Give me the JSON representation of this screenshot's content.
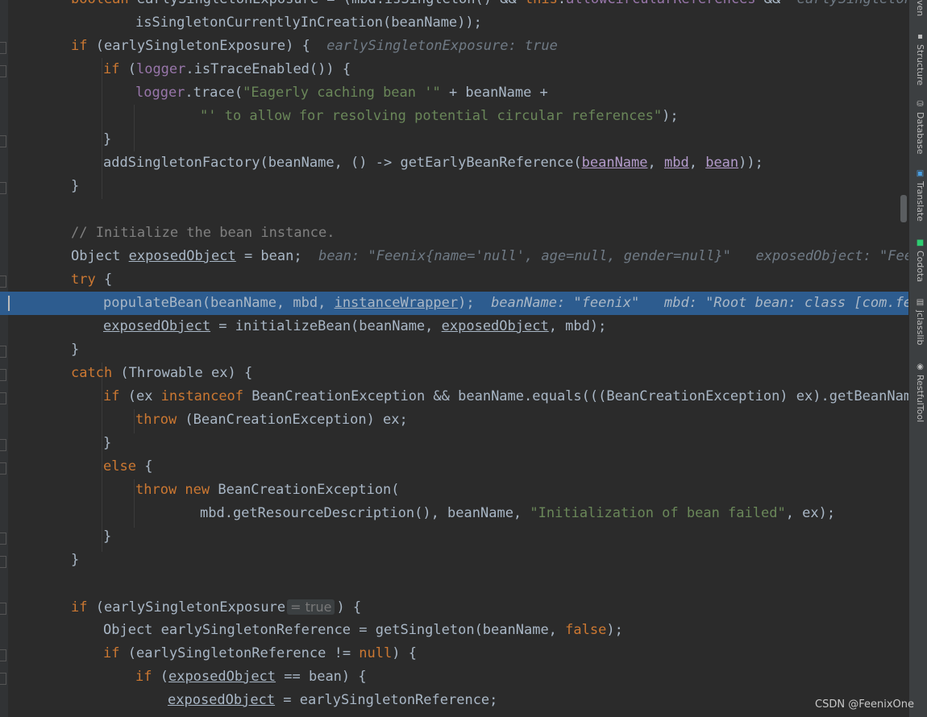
{
  "code": {
    "l0": {
      "kw1": "boolean",
      "p1": " earlySingletonExposure = (mbd.isSingleton() && ",
      "kw2": "this",
      "p2": ".",
      "f1": "allowCircularReferences",
      "p3": " &&  ",
      "hint": "earlySingletonEx"
    },
    "l1": {
      "p1": "isSingletonCurrentlyInCreation(beanName));"
    },
    "l2": {
      "kw1": "if",
      "p1": " (earlySingletonExposure) {  ",
      "hint": "earlySingletonExposure: true"
    },
    "l3": {
      "kw1": "if",
      "p1": " (",
      "f1": "logger",
      "p2": ".isTraceEnabled()) {"
    },
    "l4": {
      "f1": "logger",
      "p1": ".trace(",
      "s1": "\"Eagerly caching bean '\"",
      "p2": " + beanName +"
    },
    "l5": {
      "s1": "\"' to allow for resolving potential circular references\"",
      "p1": ");"
    },
    "l6": {
      "p1": "}"
    },
    "l7": {
      "p1": "addSingletonFactory(beanName, () -> getEarlyBeanReference(",
      "u1": "beanName",
      "p2": ", ",
      "u2": "mbd",
      "p3": ", ",
      "u3": "bean",
      "p4": "));"
    },
    "l8": {
      "p1": "}"
    },
    "l10": {
      "c1": "// Initialize the bean instance."
    },
    "l11": {
      "p1": "Object ",
      "u1": "exposedObject",
      "p2": " = bean;  ",
      "hint": "bean: \"Feenix{name='null', age=null, gender=null}\"   exposedObject: \"Feen"
    },
    "l12": {
      "kw1": "try",
      "p1": " {"
    },
    "l13": {
      "p1": "populateBean(beanName, mbd, ",
      "u1": "instanceWrapper",
      "p2": ");  ",
      "hint": "beanName: \"feenix\"   mbd: \"Root bean: class [com.fee"
    },
    "l14": {
      "u1": "exposedObject",
      "p1": " = initializeBean(beanName, ",
      "u2": "exposedObject",
      "p2": ", mbd);"
    },
    "l15": {
      "p1": "}"
    },
    "l16": {
      "kw1": "catch",
      "p1": " (Throwable ex) {"
    },
    "l17": {
      "kw1": "if",
      "p1": " (ex ",
      "kw2": "instanceof",
      "p2": " BeanCreationException && beanName.equals(((BeanCreationException) ex).getBeanName("
    },
    "l18": {
      "kw1": "throw",
      "p1": " (BeanCreationException) ex;"
    },
    "l19": {
      "p1": "}"
    },
    "l20": {
      "kw1": "else",
      "p1": " {"
    },
    "l21": {
      "kw1": "throw new",
      "p1": " BeanCreationException("
    },
    "l22": {
      "p1": "mbd.getResourceDescription(), beanName, ",
      "s1": "\"Initialization of bean failed\"",
      "p2": ", ex);"
    },
    "l23": {
      "p1": "}"
    },
    "l24": {
      "p1": "}"
    },
    "l26": {
      "kw1": "if",
      "p1": " (earlySingletonExposure",
      "badge": "= true",
      "p2": ") {"
    },
    "l27": {
      "p1": "Object earlySingletonReference = getSingleton(beanName, ",
      "kw1": "false",
      "p2": ");"
    },
    "l28": {
      "kw1": "if",
      "p1": " (earlySingletonReference != ",
      "kw2": "null",
      "p2": ") {"
    },
    "l29": {
      "kw1": "if",
      "p1": " (",
      "u1": "exposedObject",
      "p2": " == bean) {"
    },
    "l30": {
      "u1": "exposedObject",
      "p1": " = earlySingletonReference;"
    }
  },
  "toolwindows": {
    "maven": "ven",
    "structure": "Structure",
    "database": "Database",
    "translate": "Translate",
    "codota": "Codota",
    "jclasslib": "jclasslib",
    "restfultool": "RestfulTool"
  },
  "watermark": "CSDN @FeenixOne",
  "colors": {
    "background": "#2b2b2b",
    "keyword": "#cc7832",
    "string": "#6a8759",
    "comment": "#808080",
    "field": "#9876aa",
    "text": "#a9b7c6",
    "current_line": "#2d5c8f"
  }
}
